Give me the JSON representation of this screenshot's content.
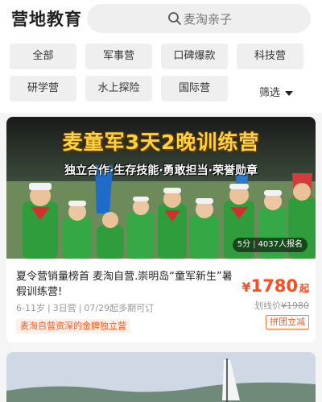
{
  "header": {
    "title": "营地教育",
    "search_placeholder": "麦淘亲子"
  },
  "filters": {
    "chips": [
      "全部",
      "军事营",
      "口碑爆款",
      "科技营",
      "研学营",
      "水上探险",
      "国际营"
    ],
    "sort_label": "筛选"
  },
  "card": {
    "banner_headline": "麦童军3天2晚训练营",
    "banner_sub": "独立合作·生存技能·勇敢担当·荣誉勋章",
    "rating": "5分",
    "enrolled": "4037人报名",
    "title": "夏令营销量榜首 麦淘自营.崇明岛“童军新生”暑假训练营!",
    "age": "6-11岁",
    "duration": "3日营",
    "dates": "07/29起多期可订",
    "tag": "麦淘自营资深的金牌独立营",
    "price_currency": "¥",
    "price": "1780",
    "price_unit": "起",
    "original_label": "划线价",
    "original_price": "¥1980",
    "group_label": "拼团立减"
  },
  "colors": {
    "accent": "#ff4b1f",
    "chip_bg": "#efefef",
    "banner_headline": "#ffd23b"
  }
}
